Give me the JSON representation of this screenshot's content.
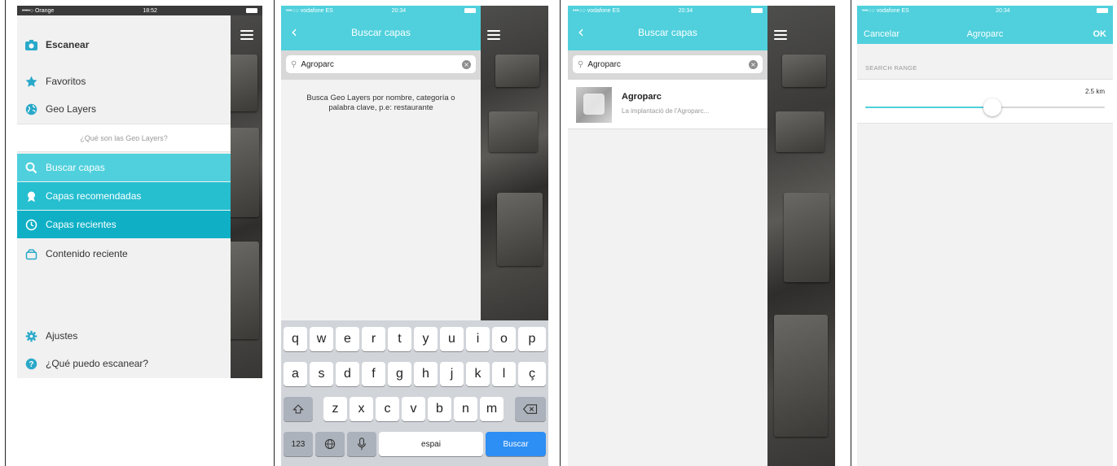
{
  "colors": {
    "accent": "#4fd0dc",
    "accent_mid": "#25bfd0",
    "accent_dark": "#0fb0c6",
    "key_blue": "#2d8ef3"
  },
  "screen1": {
    "status": {
      "carrier": "••••○ Orange",
      "time": "18:52"
    },
    "menu_items": [
      {
        "label": "Escanear",
        "icon": "camera-icon"
      },
      {
        "label": "Favoritos",
        "icon": "star-icon"
      },
      {
        "label": "Geo Layers",
        "icon": "globe-icon"
      },
      {
        "label": "Buscar capas",
        "icon": "search-icon"
      },
      {
        "label": "Capas recomendadas",
        "icon": "recommended-icon"
      },
      {
        "label": "Capas recientes",
        "icon": "clock-icon"
      },
      {
        "label": "Contenido reciente",
        "icon": "content-icon"
      },
      {
        "label": "Ajustes",
        "icon": "gear-icon"
      },
      {
        "label": "¿Qué puedo escanear?",
        "icon": "help-icon"
      }
    ],
    "geo_layers_help": "¿Qué son las Geo Layers?"
  },
  "screen2": {
    "status": {
      "carrier": "•••○○ vodafone ES",
      "time": "20:34"
    },
    "title": "Buscar capas",
    "search_value": "Agroparc",
    "hint": "Busca Geo Layers por nombre, categoría o palabra clave, p.e: restaurante",
    "keyboard": {
      "row1": [
        "q",
        "w",
        "e",
        "r",
        "t",
        "y",
        "u",
        "i",
        "o",
        "p"
      ],
      "row2": [
        "a",
        "s",
        "d",
        "f",
        "g",
        "h",
        "j",
        "k",
        "l",
        "ç"
      ],
      "row3": [
        "z",
        "x",
        "c",
        "v",
        "b",
        "n",
        "m"
      ],
      "numbers": "123",
      "space": "espai",
      "action": "Buscar"
    }
  },
  "screen3": {
    "status": {
      "carrier": "•••○○ vodafone ES",
      "time": "20:34"
    },
    "title": "Buscar capas",
    "search_value": "Agroparc",
    "result": {
      "title": "Agroparc",
      "subtitle": "La implantació de l'Agroparc..."
    }
  },
  "screen4": {
    "status": {
      "carrier": "•••○○ vodafone ES",
      "time": "20:34"
    },
    "cancel": "Cancelar",
    "title": "Agroparc",
    "ok": "OK",
    "section_label": "SEARCH RANGE",
    "range_value": "2.5 km",
    "range_fraction": 0.53
  }
}
